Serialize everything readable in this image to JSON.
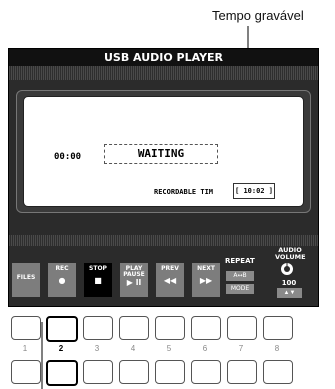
{
  "callout": "Tempo gravável",
  "screen": {
    "title": "USB AUDIO PLAYER",
    "time": "00:00",
    "status": "WAITING",
    "recordable_label": "RECORDABLE TIM",
    "recordable_value": "[ 10:02 ]",
    "repeat_label": "REPEAT",
    "repeat_mode": "A↔B",
    "repeat_sub": "MODE",
    "volume_label_1": "AUDIO",
    "volume_label_2": "VOLUME",
    "volume_value": "100",
    "volume_arrows": "▲▼"
  },
  "softkeys": [
    {
      "label": "FILES",
      "symbol": ""
    },
    {
      "label": "REC",
      "symbol": "●"
    },
    {
      "label": "STOP",
      "symbol": "■"
    },
    {
      "label": "PLAY PAUSE",
      "symbol": "▶ ll"
    },
    {
      "label": "PREV",
      "symbol": "◀◀"
    },
    {
      "label": "NEXT",
      "symbol": "▶▶"
    }
  ],
  "button_numbers": [
    "1",
    "2",
    "3",
    "4",
    "5",
    "6",
    "7",
    "8"
  ]
}
